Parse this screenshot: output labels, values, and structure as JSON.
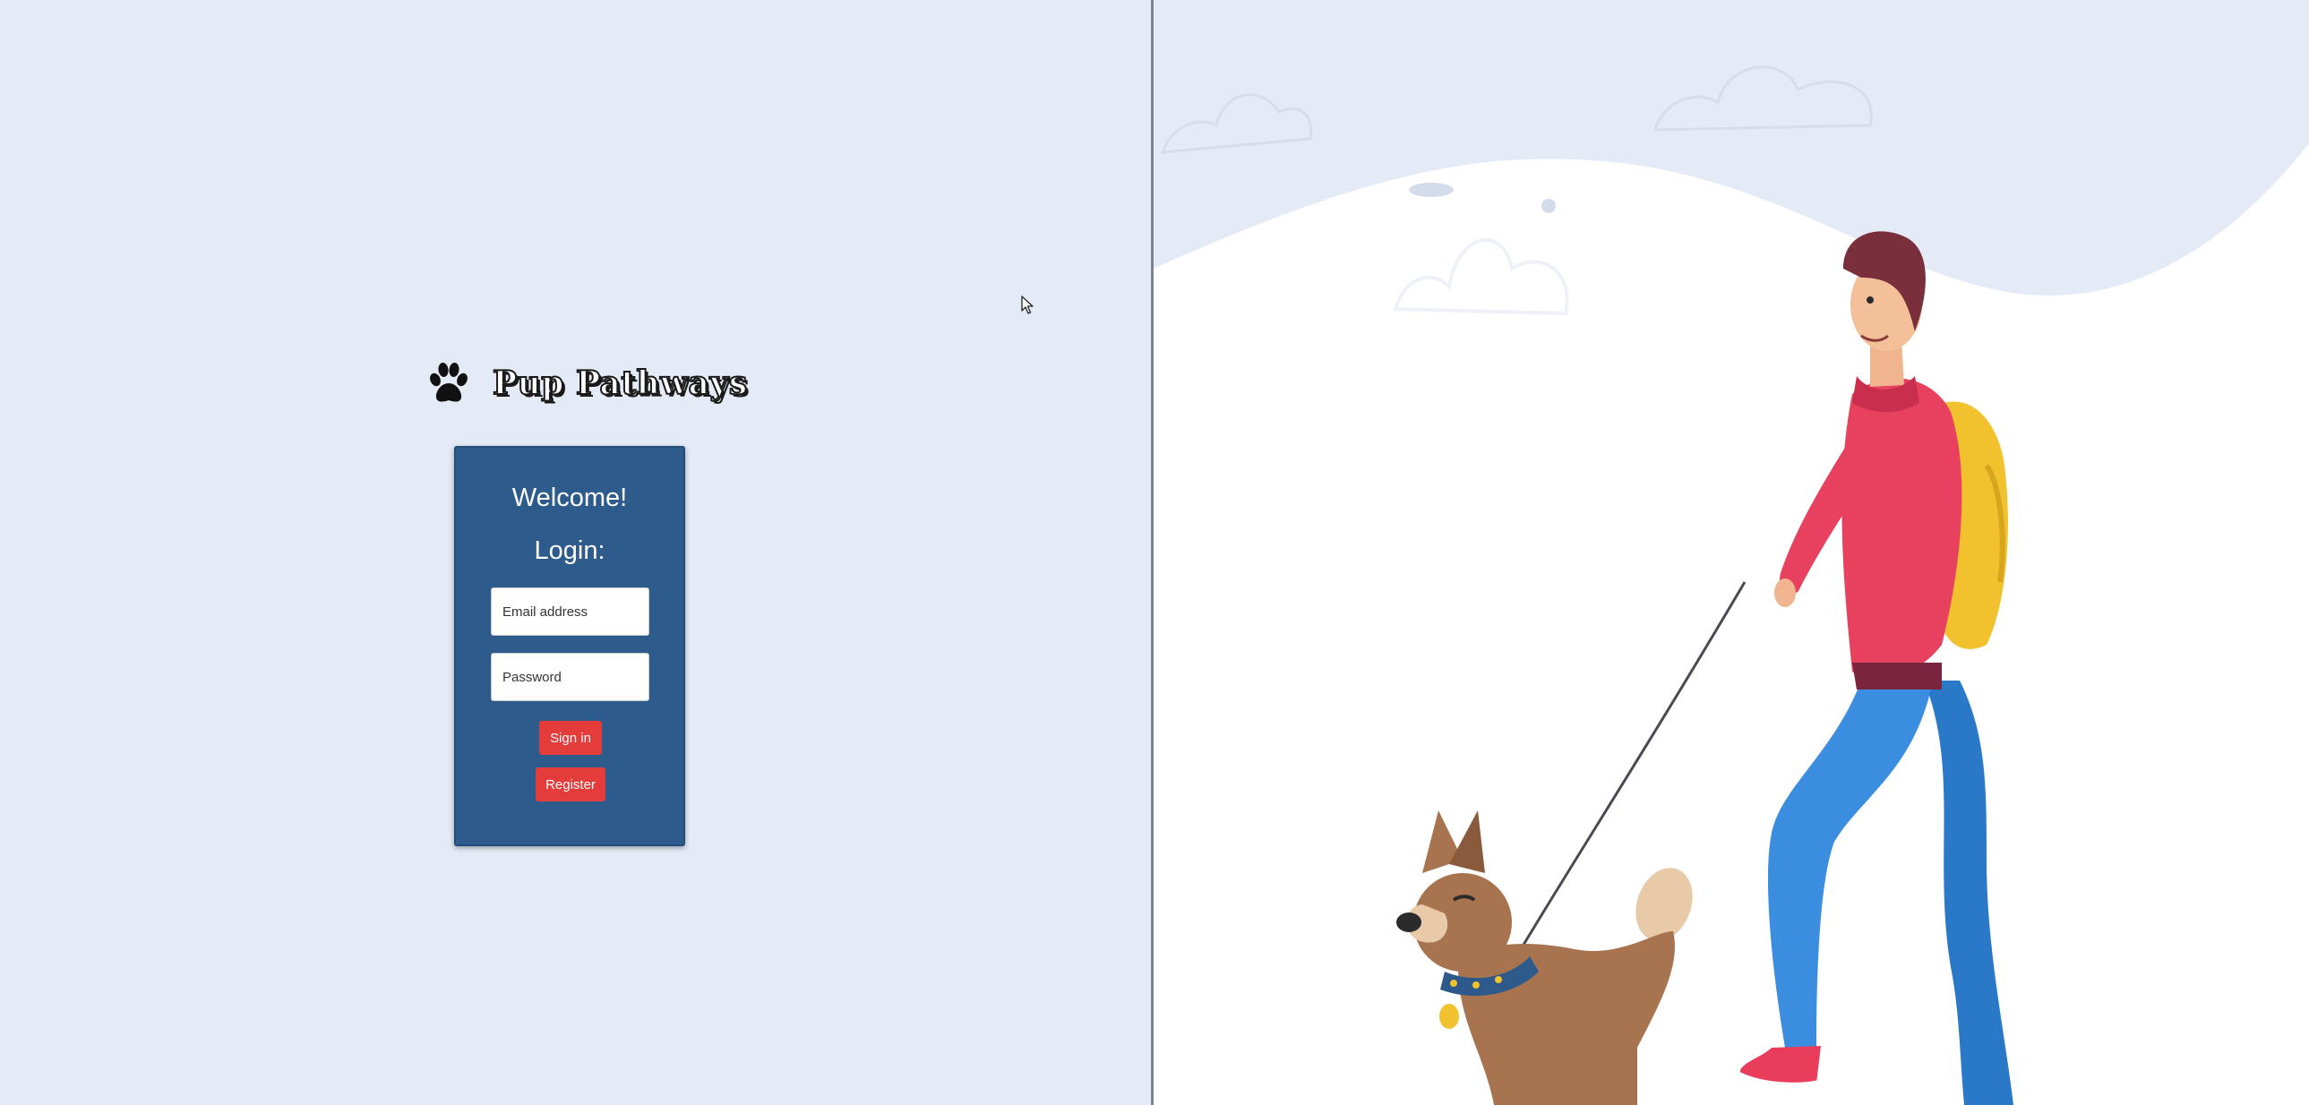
{
  "app": {
    "title": "Pup Pathways"
  },
  "login_card": {
    "welcome": "Welcome!",
    "heading": "Login:",
    "email_placeholder": "Email address",
    "email_value": "",
    "password_placeholder": "Password",
    "password_value": "",
    "sign_in_label": "Sign in",
    "register_label": "Register"
  },
  "icons": {
    "brand": "paw-icon",
    "pointer": "cursor-icon"
  },
  "illustration": {
    "subject": "man-walking-dog-illustration"
  },
  "colors": {
    "background": "#e4ebf7",
    "card": "#2c5b8c",
    "button": "#e43b3b",
    "divider": "#7b8491"
  }
}
